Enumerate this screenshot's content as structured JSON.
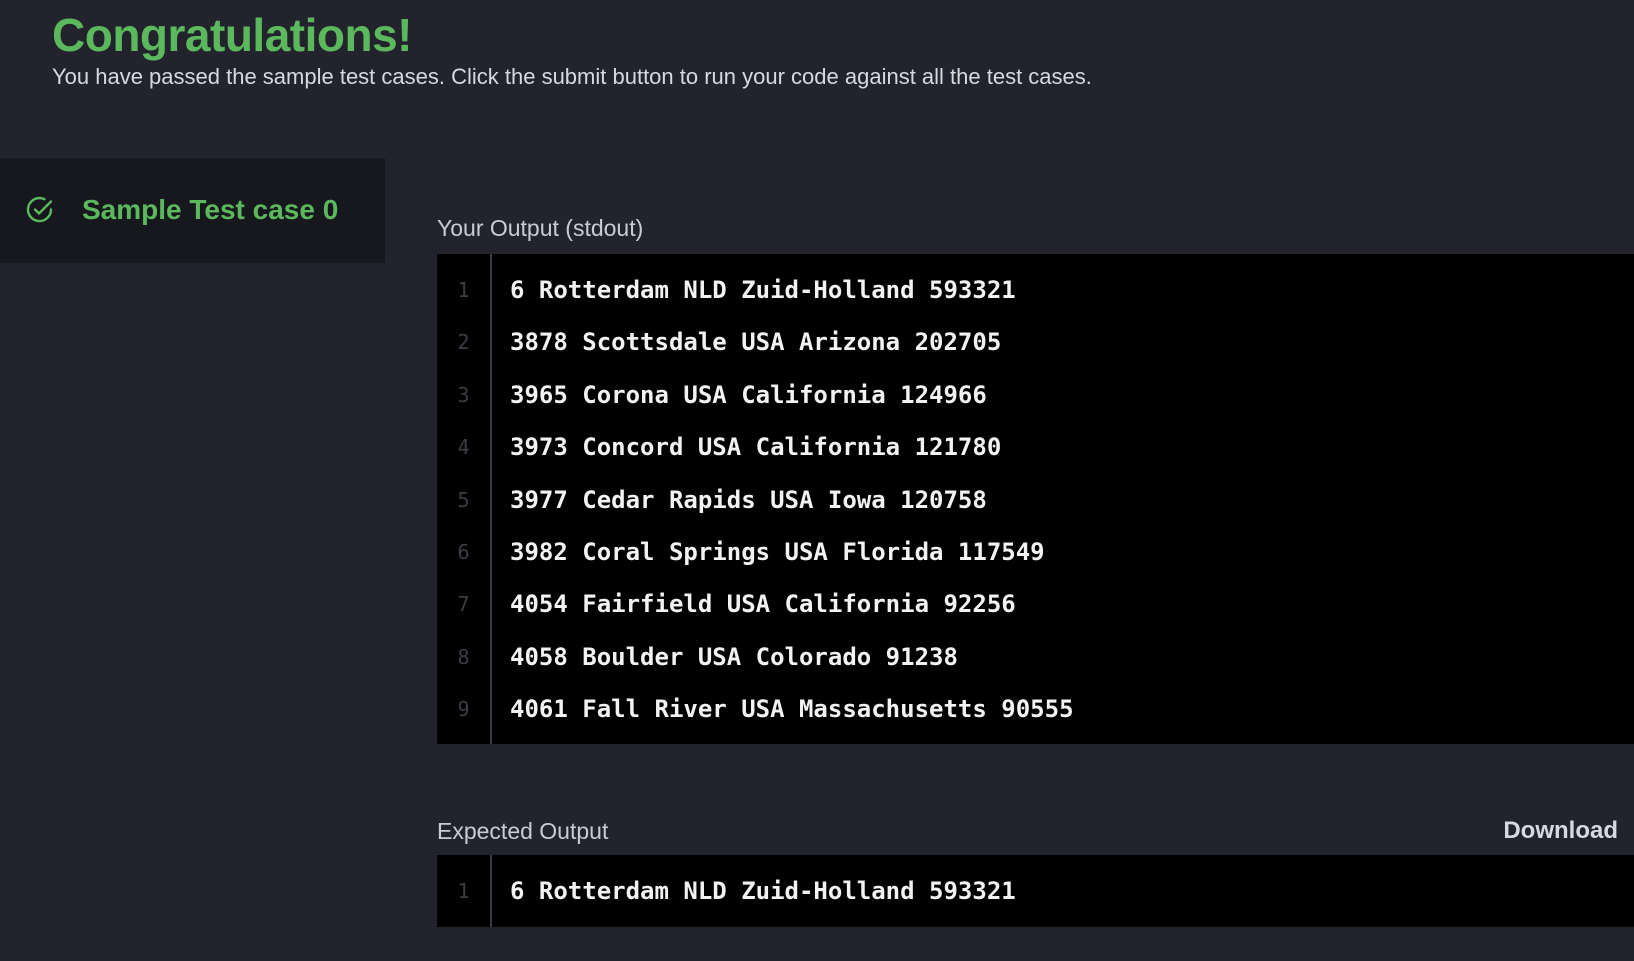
{
  "header": {
    "title": "Congratulations!",
    "subtitle": "You have passed the sample test cases. Click the submit button to run your code against all the test cases."
  },
  "sidebar": {
    "tab_label": "Sample Test case 0",
    "tab_icon": "check-circle-icon",
    "accent_color": "#5cb85c"
  },
  "your_output": {
    "label": "Your Output (stdout)",
    "lines": [
      {
        "num": "1",
        "text": "6 Rotterdam NLD Zuid-Holland 593321"
      },
      {
        "num": "2",
        "text": "3878 Scottsdale USA Arizona 202705"
      },
      {
        "num": "3",
        "text": "3965 Corona USA California 124966"
      },
      {
        "num": "4",
        "text": "3973 Concord USA California 121780"
      },
      {
        "num": "5",
        "text": "3977 Cedar Rapids USA Iowa 120758"
      },
      {
        "num": "6",
        "text": "3982 Coral Springs USA Florida 117549"
      },
      {
        "num": "7",
        "text": "4054 Fairfield USA California 92256"
      },
      {
        "num": "8",
        "text": "4058 Boulder USA Colorado 91238"
      },
      {
        "num": "9",
        "text": "4061 Fall River USA Massachusetts 90555"
      }
    ]
  },
  "expected_output": {
    "label": "Expected Output",
    "download_label": "Download",
    "lines": [
      {
        "num": "1",
        "text": "6 Rotterdam NLD Zuid-Holland 593321"
      }
    ]
  }
}
